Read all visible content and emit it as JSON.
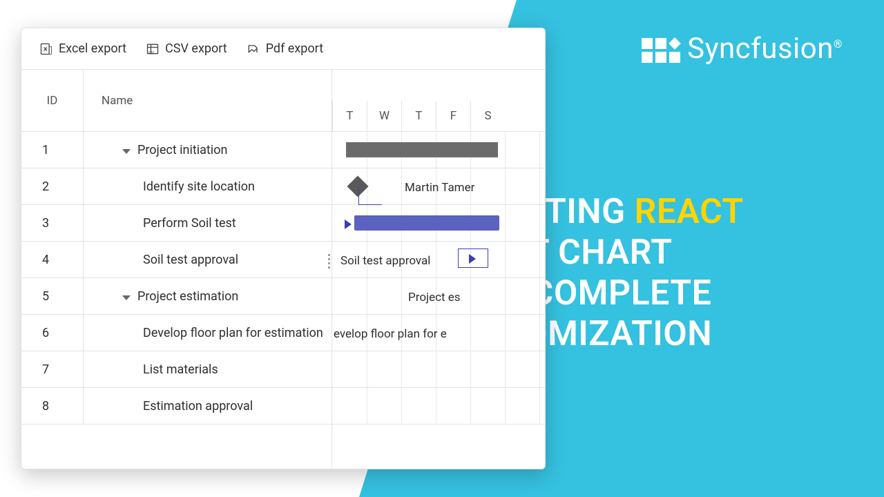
{
  "brand": {
    "name": "Syncfusion",
    "reg": "®"
  },
  "headline": {
    "pre": "EXPORTING ",
    "accent": "REACT",
    "mid": "GANTT CHART",
    "post1": "WITH COMPLETE",
    "post2": "CUSTOMIZATION"
  },
  "toolbar": {
    "excel": "Excel export",
    "csv": "CSV export",
    "pdf": "Pdf export"
  },
  "columns": {
    "id": "ID",
    "name": "Name"
  },
  "days": [
    "T",
    "W",
    "T",
    "F",
    "S"
  ],
  "rows": [
    {
      "id": "1",
      "name": "Project initiation",
      "indent": 1,
      "parent": true
    },
    {
      "id": "2",
      "name": "Identify site location",
      "indent": 2,
      "parent": false
    },
    {
      "id": "3",
      "name": "Perform Soil test",
      "indent": 2,
      "parent": false
    },
    {
      "id": "4",
      "name": "Soil test approval",
      "indent": 2,
      "parent": false
    },
    {
      "id": "5",
      "name": "Project estimation",
      "indent": 1,
      "parent": true
    },
    {
      "id": "6",
      "name": "Develop floor plan for estimation",
      "indent": 2,
      "parent": false
    },
    {
      "id": "7",
      "name": "List materials",
      "indent": 2,
      "parent": false
    },
    {
      "id": "8",
      "name": "Estimation approval",
      "indent": 2,
      "parent": false
    }
  ],
  "chart_labels": {
    "r2": "Martin Tamer",
    "r4": "Soil test approval",
    "r5": "Project es",
    "r6": "evelop floor plan for e"
  },
  "colors": {
    "accent_cyan": "#35c1e0",
    "accent_yellow": "#ffd400",
    "task_bar": "#5b62c0",
    "summary_bar": "#6b6b6b"
  }
}
